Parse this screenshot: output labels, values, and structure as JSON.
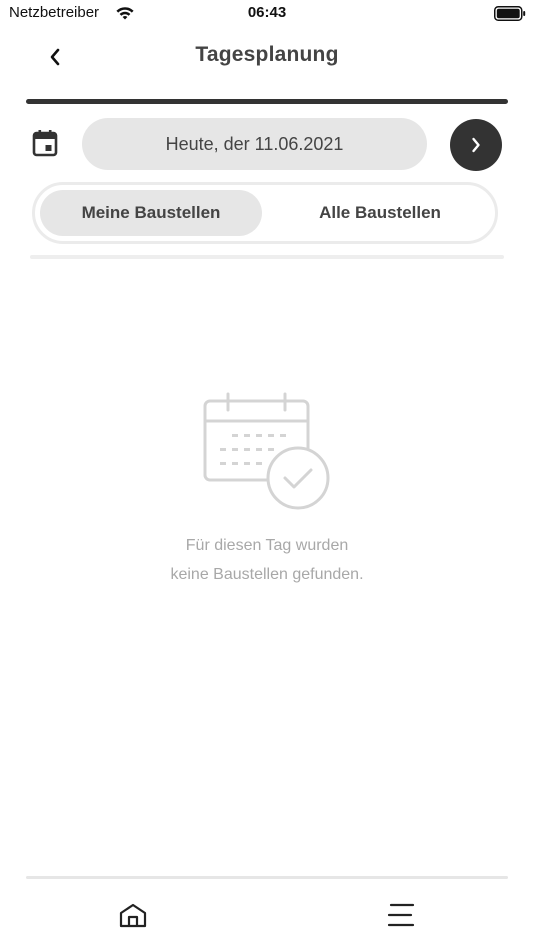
{
  "status_bar": {
    "carrier": "Netzbetreiber",
    "time": "06:43",
    "icons": [
      "wifi-icon",
      "battery-icon"
    ]
  },
  "header": {
    "title": "Tagesplanung",
    "back_icon": "chevron-left-icon"
  },
  "date_bar": {
    "calendar_icon": "calendar-icon",
    "date_label": "Heute, der 11.06.2021",
    "next_icon": "chevron-right-icon"
  },
  "tabs": [
    {
      "label": "Meine Baustellen",
      "active": true
    },
    {
      "label": "Alle Baustellen",
      "active": false
    }
  ],
  "empty_state": {
    "icon": "calendar-check-icon",
    "line1": "Für diesen Tag wurden",
    "line2": "keine Baustellen gefunden."
  },
  "bottom_nav": {
    "items": [
      {
        "icon": "home-icon"
      },
      {
        "icon": "menu-icon"
      }
    ]
  },
  "colors": {
    "dark": "#333333",
    "pill_bg": "#e6e6e6",
    "muted_text": "#a8a8a8",
    "illustration": "#d4d4d4"
  }
}
